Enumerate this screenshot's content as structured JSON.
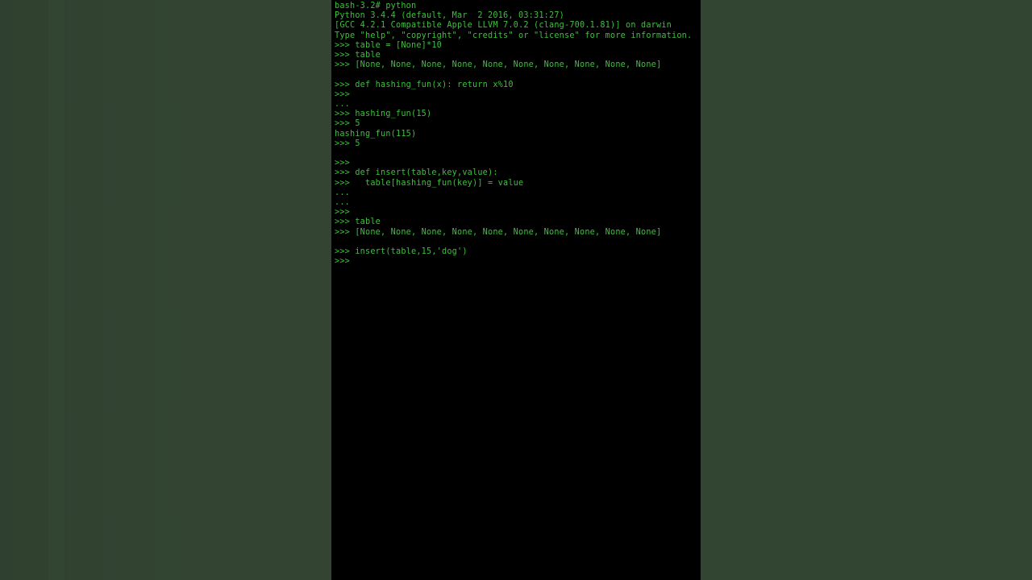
{
  "terminal": {
    "lines": [
      "bash-3.2# python",
      "Python 3.4.4 (default, Mar  2 2016, 03:31:27)",
      "[GCC 4.2.1 Compatible Apple LLVM 7.0.2 (clang-700.1.81)] on darwin",
      "Type \"help\", \"copyright\", \"credits\" or \"license\" for more information.",
      ">>> table = [None]*10",
      ">>> table",
      ">>> [None, None, None, None, None, None, None, None, None, None]",
      "",
      ">>> def hashing_fun(x): return x%10",
      ">>> ",
      "... ",
      ">>> hashing_fun(15)",
      ">>> 5",
      "hashing_fun(115)",
      ">>> 5",
      "",
      ">>> ",
      ">>> def insert(table,key,value):",
      ">>>   table[hashing_fun(key)] = value",
      "... ",
      "... ",
      ">>> ",
      ">>> table",
      ">>> [None, None, None, None, None, None, None, None, None, None]",
      "",
      ">>> insert(table,15,'dog')",
      ">>> "
    ]
  }
}
